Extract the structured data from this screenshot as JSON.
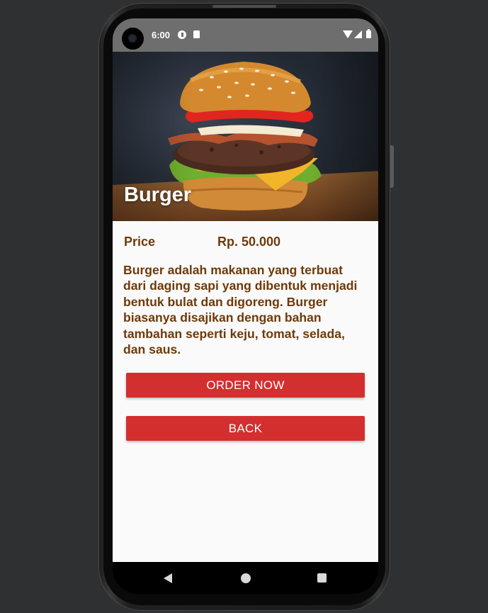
{
  "status_bar": {
    "time": "6:00",
    "icons": [
      "notification-circle-icon",
      "sd-card-icon",
      "wifi-icon",
      "signal-icon",
      "battery-icon"
    ]
  },
  "hero": {
    "image": "burger-photo",
    "title": "Burger"
  },
  "detail": {
    "price_label": "Price",
    "price_value": "Rp. 50.000",
    "description": "Burger adalah makanan yang terbuat dari daging sapi yang dibentuk menjadi bentuk bulat dan digoreng. Burger biasanya disajikan dengan bahan tambahan seperti keju, tomat, selada, dan saus."
  },
  "buttons": {
    "order_label": "ORDER NOW",
    "back_label": "BACK"
  },
  "nav_bar": {
    "icons": [
      "back-triangle-icon",
      "home-circle-icon",
      "recents-square-icon"
    ]
  },
  "colors": {
    "accent_button": "#d32f2f",
    "text_brown": "#6e3a0a",
    "status_bar": "#6e6e6e",
    "background": "#fafafa"
  }
}
